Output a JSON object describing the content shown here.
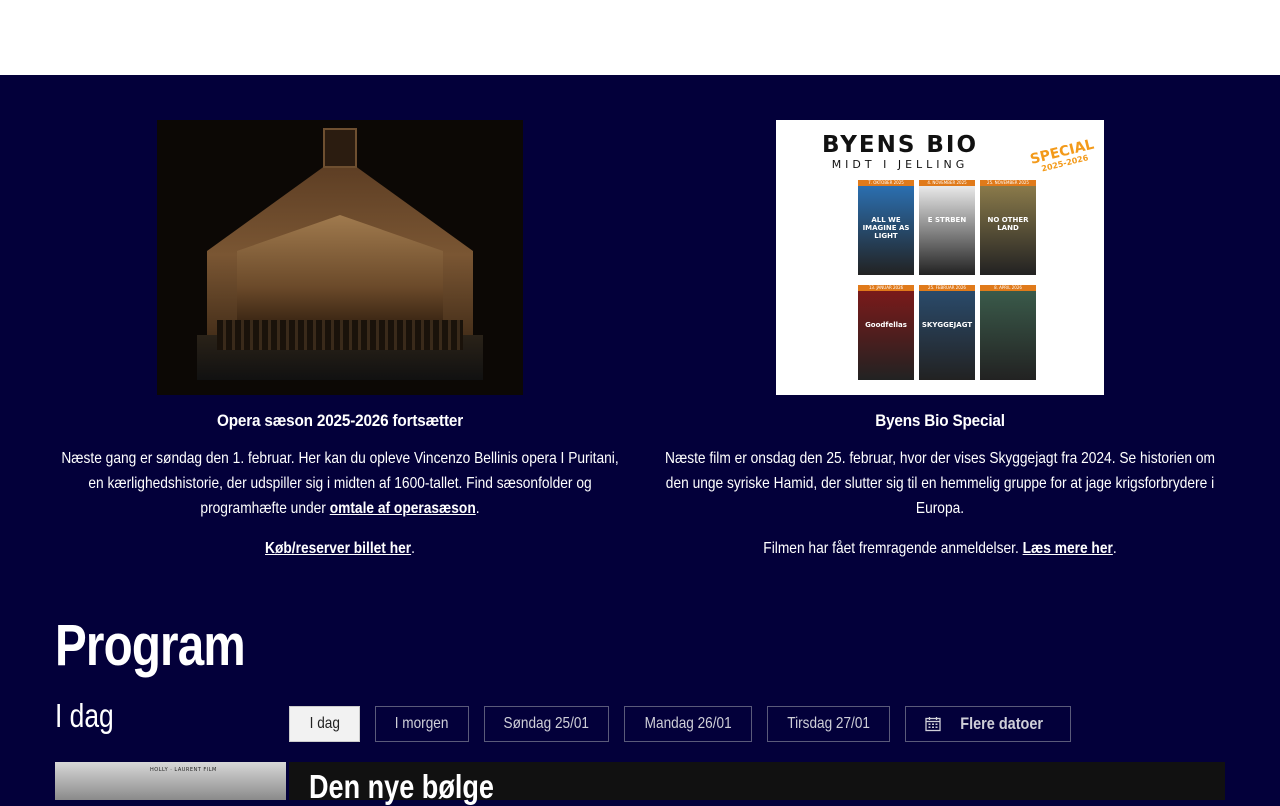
{
  "features": [
    {
      "title": "Opera sæson 2025-2026 fortsætter",
      "para1_text": "Næste gang er søndag den 1. februar. Her kan du opleve Vincenzo Bellinis opera I Puritani, en kærlighedshistorie, der udspiller sig i midten af 1600-tallet. Find sæsonfolder og programhæfte under",
      "para1_link": "omtale af operasæson",
      "para1_end": ".",
      "para2_link": "Køb/reserver billet her",
      "para2_end": "."
    },
    {
      "title": "Byens Bio Special",
      "para1_text": "Næste film er onsdag den 25. februar, hvor der vises Skyggejagt fra 2024. Se historien om den unge syriske Hamid, der slutter sig til en hemmelig gruppe for at jage krigsforbrydere i Europa.",
      "para2_text": "Filmen har fået fremragende anmeldelser.",
      "para2_link": "Læs mere her",
      "para2_end": "."
    }
  ],
  "poster": {
    "title": "BYENS BIO",
    "subtitle": "MIDT I JELLING",
    "special": "SPECIAL",
    "season": "2025-2026",
    "films": [
      {
        "date": "7. OKTOBER 2025",
        "name": "ALL WE IMAGINE AS LIGHT",
        "color": "#2b6fb0"
      },
      {
        "date": "4. NOVEMBER 2025",
        "name": "E STRBEN",
        "color": "#e9e9e9"
      },
      {
        "date": "25. NOVEMBER 2025",
        "name": "NO OTHER LAND",
        "color": "#8a7a4a"
      },
      {
        "date": "13. JANUAR 2026",
        "name": "Goodfellas",
        "color": "#7a1a1a"
      },
      {
        "date": "25. FEBRUAR 2026",
        "name": "SKYGGEJAGT",
        "color": "#2a4a6a"
      },
      {
        "date": "8. APRIL 2026",
        "name": "",
        "color": "#3a5a4a"
      }
    ]
  },
  "program": {
    "title": "Program",
    "day_label": "I dag",
    "tabs": [
      "I dag",
      "I morgen",
      "Søndag 25/01",
      "Mandag 26/01",
      "Tirsdag 27/01"
    ],
    "more_dates": "Flere datoer",
    "movie_title": "Den nye bølge",
    "thumb_caption": "HOLLY · LAURENT FILM"
  },
  "colors": {
    "background": "#03003a",
    "card": "#111111",
    "poster_accent": "#f39a1a"
  }
}
